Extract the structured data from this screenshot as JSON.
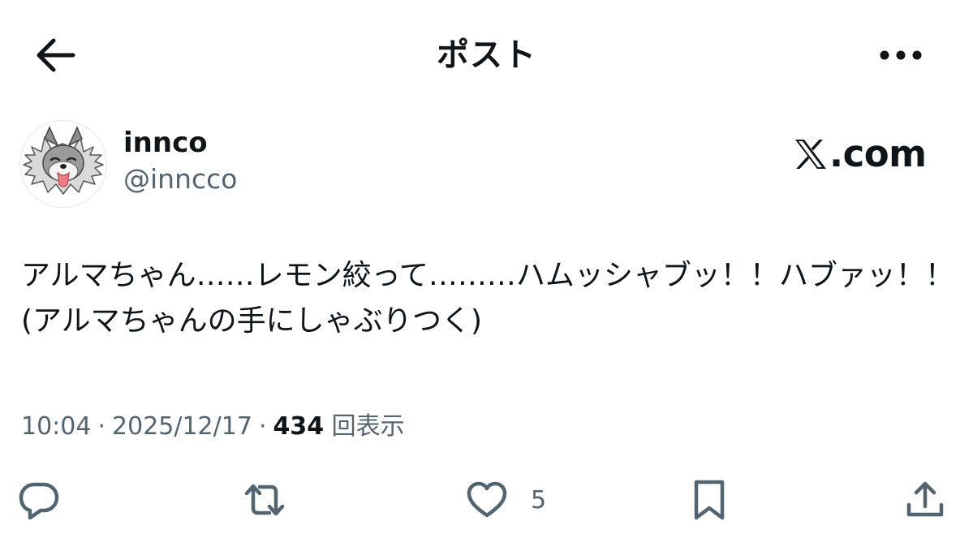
{
  "header": {
    "title": "ポスト",
    "back_icon": "arrow-left-icon",
    "more_icon": "more-horizontal-icon"
  },
  "author": {
    "display_name": "innco",
    "handle": "@inncco"
  },
  "watermark": {
    "domain": ".com"
  },
  "post": {
    "text": "アルマちゃん……レモン絞って………ハムッシャブッ！！ハブァッ！！(アルマちゃんの手にしゃぶりつく)"
  },
  "meta": {
    "time": "10:04",
    "date": "2025/12/17",
    "views_count": "434",
    "views_label": "回表示"
  },
  "actions": {
    "reply_icon": "reply-icon",
    "repost_icon": "repost-icon",
    "like_icon": "heart-icon",
    "like_count": "5",
    "bookmark_icon": "bookmark-icon",
    "share_icon": "share-icon"
  },
  "colors": {
    "text": "#0f1419",
    "secondary": "#536471",
    "background": "#ffffff"
  }
}
